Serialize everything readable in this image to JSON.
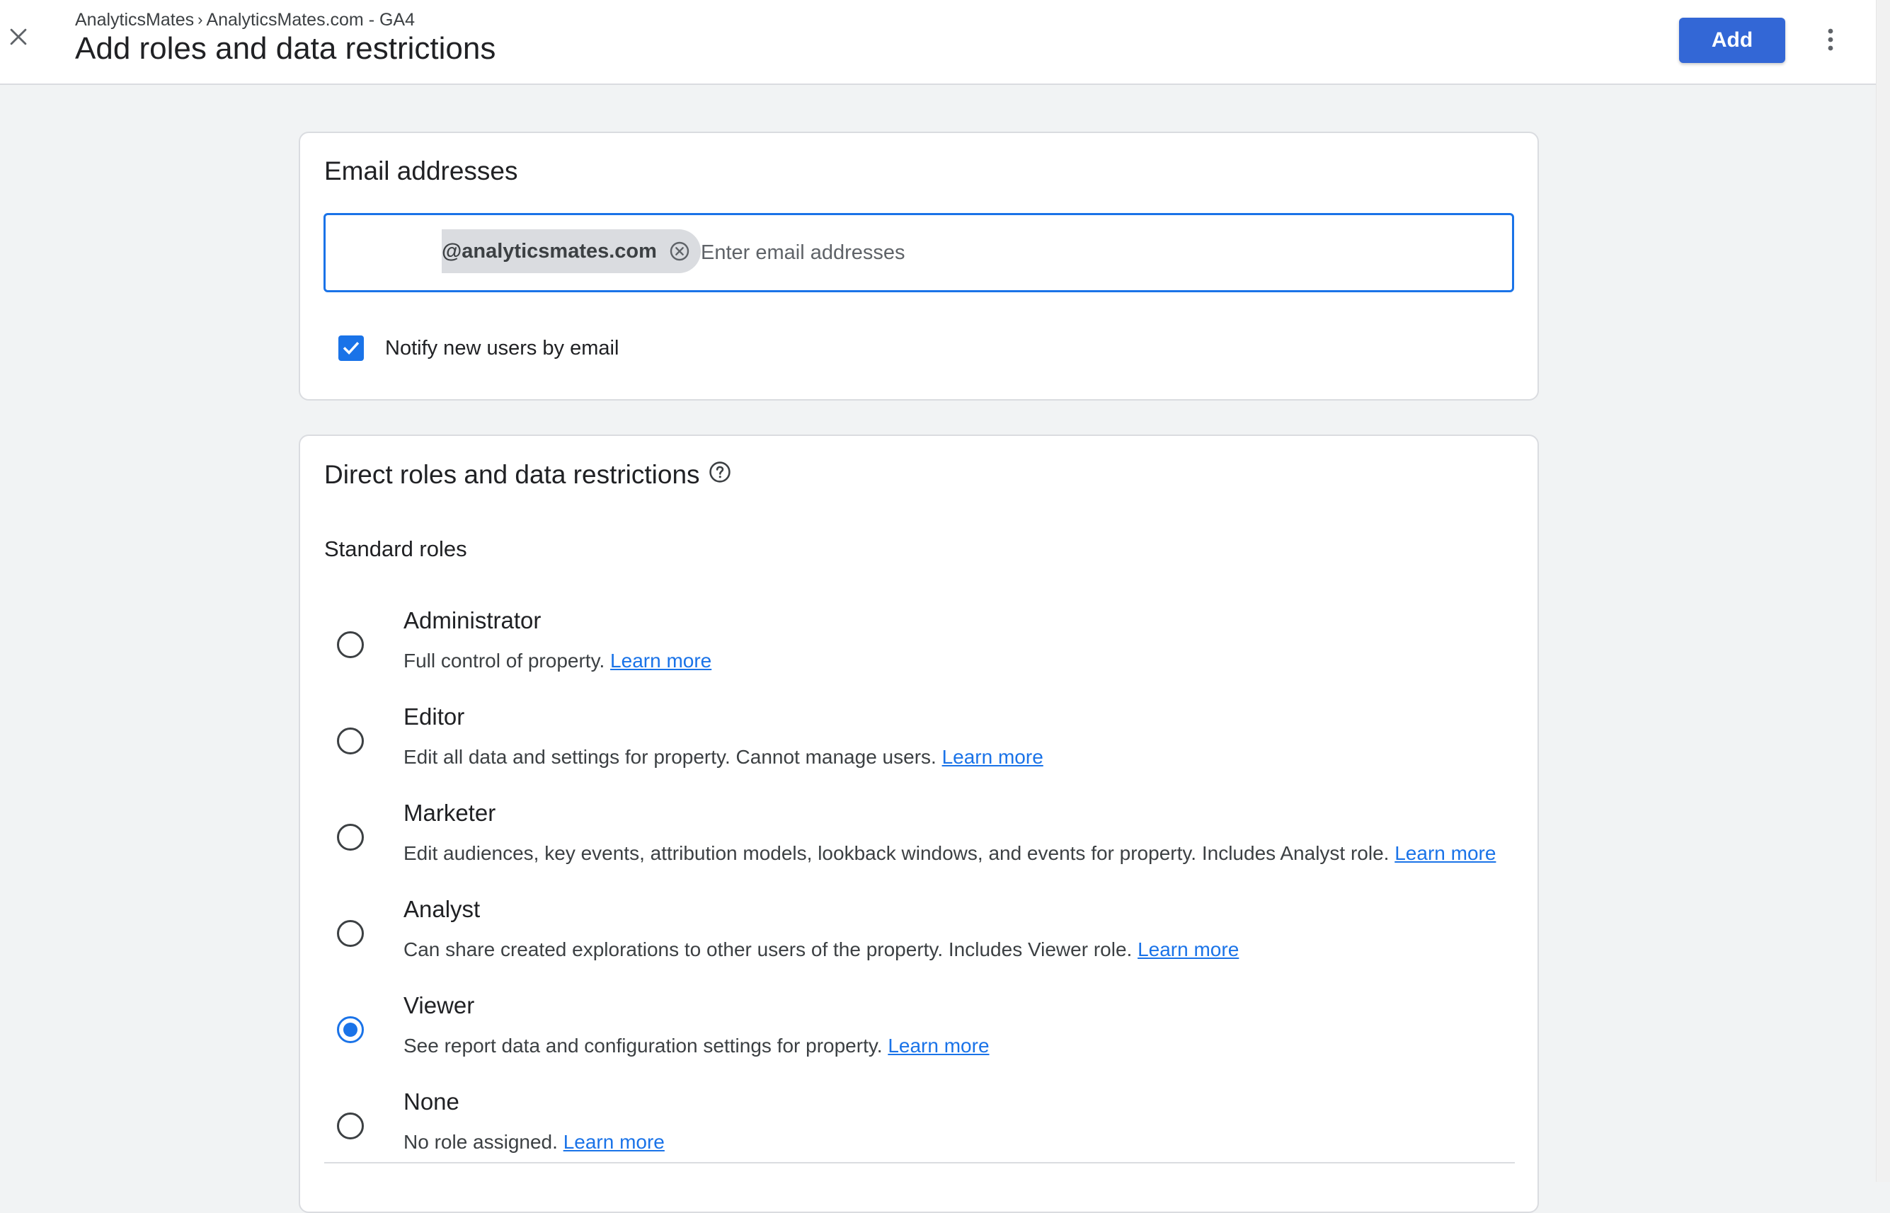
{
  "header": {
    "breadcrumb_account": "AnalyticsMates",
    "breadcrumb_separator": "›",
    "breadcrumb_property": "AnalyticsMates.com - GA4",
    "title": "Add roles and data restrictions",
    "add_label": "Add",
    "close_icon": "close-icon",
    "more_icon": "more-vert-icon"
  },
  "email_section": {
    "heading": "Email addresses",
    "chip_email": "@analyticsmates.com",
    "input_placeholder": "Enter email addresses",
    "input_value": "",
    "notify_label": "Notify new users by email",
    "notify_checked": true
  },
  "roles_section": {
    "heading": "Direct roles and data restrictions",
    "subheading": "Standard roles",
    "selected": "Viewer",
    "learn_more": "Learn more",
    "roles": [
      {
        "name": "Administrator",
        "description": "Full control of property."
      },
      {
        "name": "Editor",
        "description": "Edit all data and settings for property. Cannot manage users."
      },
      {
        "name": "Marketer",
        "description": "Edit audiences, key events, attribution models, lookback windows, and events for property. Includes Analyst role."
      },
      {
        "name": "Analyst",
        "description": "Can share created explorations to other users of the property. Includes Viewer role."
      },
      {
        "name": "Viewer",
        "description": "See report data and configuration settings for property."
      },
      {
        "name": "None",
        "description": "No role assigned."
      }
    ]
  },
  "colors": {
    "accent": "#1a73e8",
    "add_button": "#3367d6",
    "background": "#f1f3f4"
  }
}
